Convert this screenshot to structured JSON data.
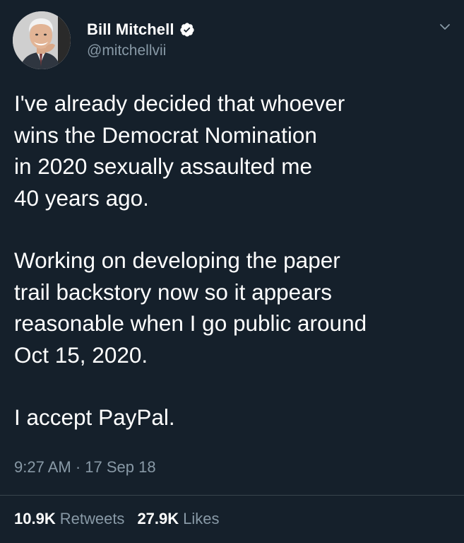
{
  "author": {
    "display_name": "Bill Mitchell",
    "handle": "@mitchellvii",
    "verified": true,
    "avatar_icon": "profile-photo"
  },
  "tweet": {
    "paragraphs": [
      "I've already decided that whoever wins the Democrat Nomination in 2020 sexually assaulted me 40 years ago.",
      "Working on developing the paper trail backstory now so it appears reasonable when I go public around Oct 15, 2020.",
      "I accept PayPal."
    ],
    "lines": [
      [
        "I've already decided that whoever",
        "wins the Democrat Nomination",
        "in 2020 sexually assaulted me",
        "40 years ago."
      ],
      [
        "Working on developing the paper",
        "trail backstory now so it appears",
        "reasonable when I go public around",
        "Oct 15, 2020."
      ],
      [
        "I accept PayPal."
      ]
    ],
    "timestamp": "9:27 AM · 17 Sep 18"
  },
  "stats": {
    "retweets_count": "10.9K",
    "retweets_label": "Retweets",
    "likes_count": "27.9K",
    "likes_label": "Likes"
  },
  "icons": {
    "verified": "verified-badge-icon",
    "menu": "chevron-down-icon"
  },
  "colors": {
    "background": "#15202b",
    "text": "#ffffff",
    "secondary_text": "#8899a6",
    "divider": "#38444d"
  }
}
